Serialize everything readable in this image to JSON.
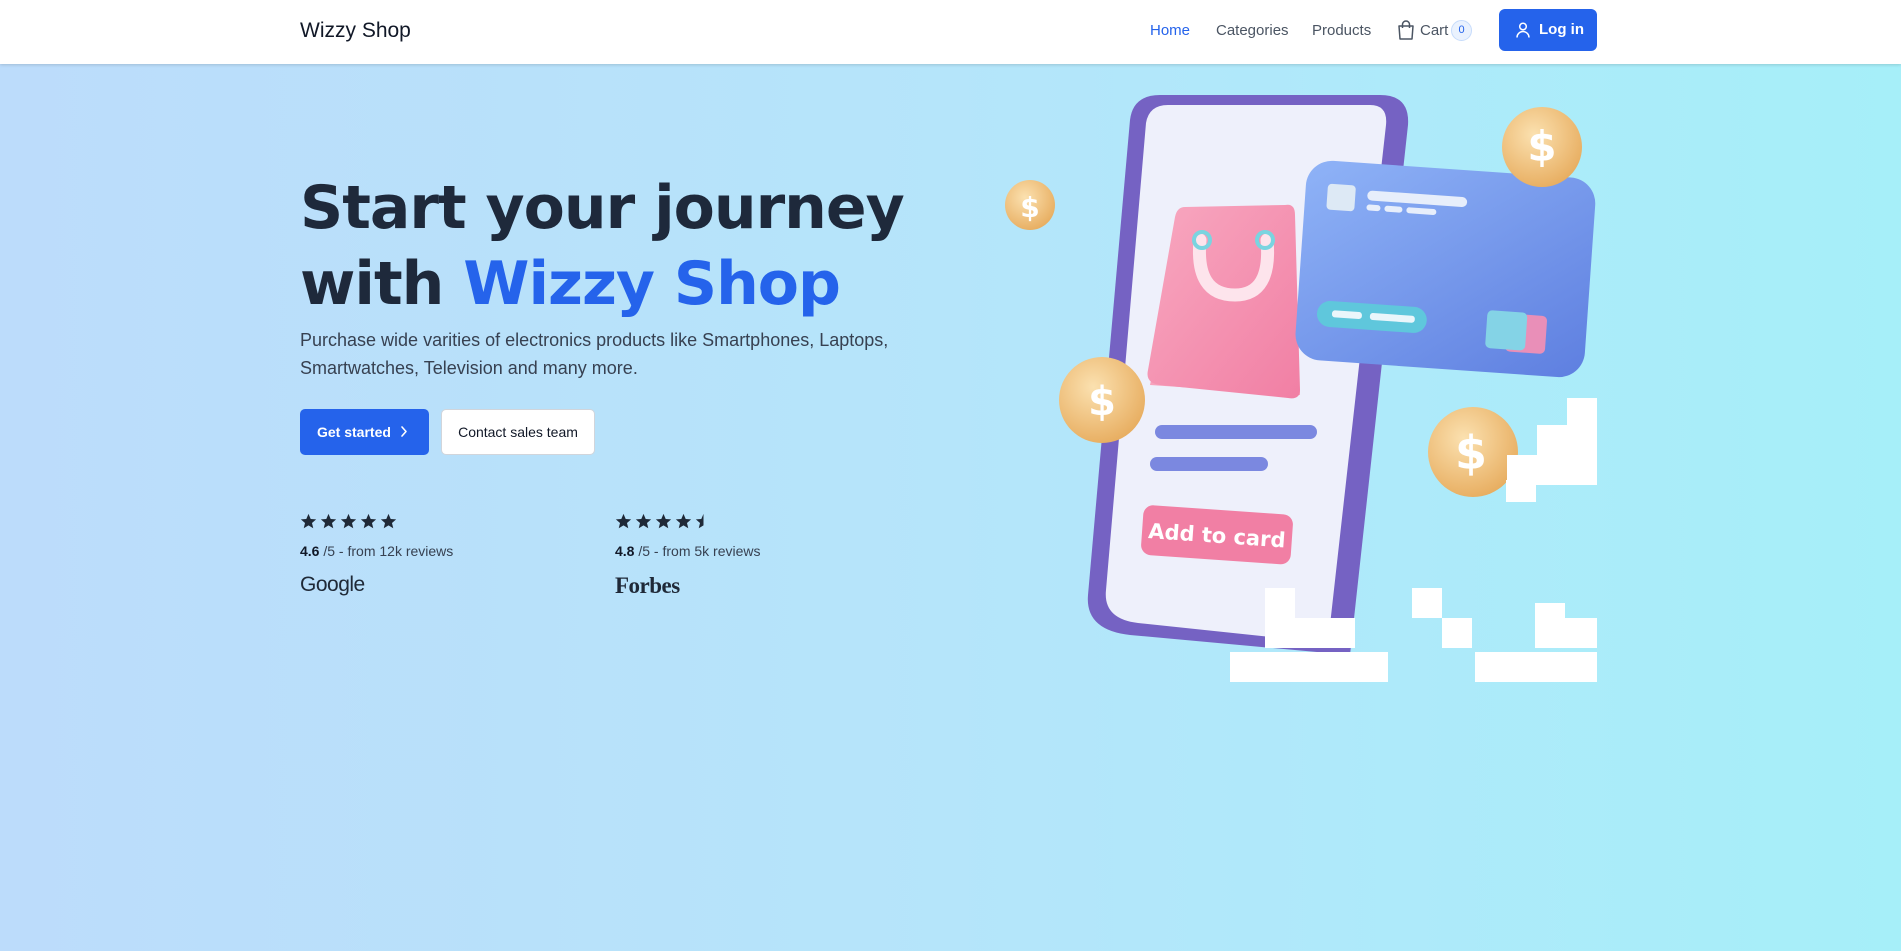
{
  "header": {
    "brand": "Wizzy Shop",
    "nav": [
      {
        "label": "Home",
        "active": true
      },
      {
        "label": "Categories",
        "active": false
      },
      {
        "label": "Products",
        "active": false
      },
      {
        "label": "Cart",
        "active": false
      }
    ],
    "cart_count": "0",
    "login_label": "Log in",
    "icons": {
      "cart": "shopping-bag-icon",
      "user": "user-icon"
    }
  },
  "hero": {
    "title_line1": "Start your journey",
    "title_prefix": "with ",
    "title_accent": "Wizzy Shop",
    "description": "Purchase wide varities of electronics products like Smartphones, Laptops, Smartwatches, Television and many more.",
    "primary_cta": "Get started",
    "secondary_cta": "Contact sales team"
  },
  "ratings": [
    {
      "score": "4.6",
      "suffix": " /5 - from 12k reviews",
      "source": "Google",
      "stars": 5
    },
    {
      "score": "4.8",
      "suffix": " /5 - from 5k reviews",
      "source": "Forbes",
      "stars": 4.5
    }
  ],
  "illustration": {
    "phone_button_text": "Add to card"
  },
  "colors": {
    "accent": "#2563eb",
    "heading": "#1e293b",
    "bg_left": "#bcdcfb",
    "bg_right": "#a6eff9"
  }
}
